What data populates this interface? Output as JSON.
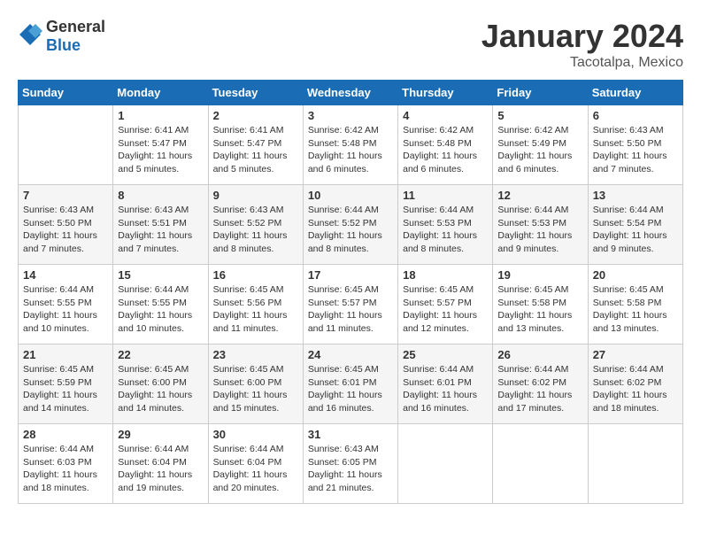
{
  "logo": {
    "general": "General",
    "blue": "Blue"
  },
  "header": {
    "month": "January 2024",
    "location": "Tacotalpa, Mexico"
  },
  "weekdays": [
    "Sunday",
    "Monday",
    "Tuesday",
    "Wednesday",
    "Thursday",
    "Friday",
    "Saturday"
  ],
  "weeks": [
    [
      {
        "day": "",
        "info": ""
      },
      {
        "day": "1",
        "info": "Sunrise: 6:41 AM\nSunset: 5:47 PM\nDaylight: 11 hours\nand 5 minutes."
      },
      {
        "day": "2",
        "info": "Sunrise: 6:41 AM\nSunset: 5:47 PM\nDaylight: 11 hours\nand 5 minutes."
      },
      {
        "day": "3",
        "info": "Sunrise: 6:42 AM\nSunset: 5:48 PM\nDaylight: 11 hours\nand 6 minutes."
      },
      {
        "day": "4",
        "info": "Sunrise: 6:42 AM\nSunset: 5:48 PM\nDaylight: 11 hours\nand 6 minutes."
      },
      {
        "day": "5",
        "info": "Sunrise: 6:42 AM\nSunset: 5:49 PM\nDaylight: 11 hours\nand 6 minutes."
      },
      {
        "day": "6",
        "info": "Sunrise: 6:43 AM\nSunset: 5:50 PM\nDaylight: 11 hours\nand 7 minutes."
      }
    ],
    [
      {
        "day": "7",
        "info": "Sunrise: 6:43 AM\nSunset: 5:50 PM\nDaylight: 11 hours\nand 7 minutes."
      },
      {
        "day": "8",
        "info": "Sunrise: 6:43 AM\nSunset: 5:51 PM\nDaylight: 11 hours\nand 7 minutes."
      },
      {
        "day": "9",
        "info": "Sunrise: 6:43 AM\nSunset: 5:52 PM\nDaylight: 11 hours\nand 8 minutes."
      },
      {
        "day": "10",
        "info": "Sunrise: 6:44 AM\nSunset: 5:52 PM\nDaylight: 11 hours\nand 8 minutes."
      },
      {
        "day": "11",
        "info": "Sunrise: 6:44 AM\nSunset: 5:53 PM\nDaylight: 11 hours\nand 8 minutes."
      },
      {
        "day": "12",
        "info": "Sunrise: 6:44 AM\nSunset: 5:53 PM\nDaylight: 11 hours\nand 9 minutes."
      },
      {
        "day": "13",
        "info": "Sunrise: 6:44 AM\nSunset: 5:54 PM\nDaylight: 11 hours\nand 9 minutes."
      }
    ],
    [
      {
        "day": "14",
        "info": "Sunrise: 6:44 AM\nSunset: 5:55 PM\nDaylight: 11 hours\nand 10 minutes."
      },
      {
        "day": "15",
        "info": "Sunrise: 6:44 AM\nSunset: 5:55 PM\nDaylight: 11 hours\nand 10 minutes."
      },
      {
        "day": "16",
        "info": "Sunrise: 6:45 AM\nSunset: 5:56 PM\nDaylight: 11 hours\nand 11 minutes."
      },
      {
        "day": "17",
        "info": "Sunrise: 6:45 AM\nSunset: 5:57 PM\nDaylight: 11 hours\nand 11 minutes."
      },
      {
        "day": "18",
        "info": "Sunrise: 6:45 AM\nSunset: 5:57 PM\nDaylight: 11 hours\nand 12 minutes."
      },
      {
        "day": "19",
        "info": "Sunrise: 6:45 AM\nSunset: 5:58 PM\nDaylight: 11 hours\nand 13 minutes."
      },
      {
        "day": "20",
        "info": "Sunrise: 6:45 AM\nSunset: 5:58 PM\nDaylight: 11 hours\nand 13 minutes."
      }
    ],
    [
      {
        "day": "21",
        "info": "Sunrise: 6:45 AM\nSunset: 5:59 PM\nDaylight: 11 hours\nand 14 minutes."
      },
      {
        "day": "22",
        "info": "Sunrise: 6:45 AM\nSunset: 6:00 PM\nDaylight: 11 hours\nand 14 minutes."
      },
      {
        "day": "23",
        "info": "Sunrise: 6:45 AM\nSunset: 6:00 PM\nDaylight: 11 hours\nand 15 minutes."
      },
      {
        "day": "24",
        "info": "Sunrise: 6:45 AM\nSunset: 6:01 PM\nDaylight: 11 hours\nand 16 minutes."
      },
      {
        "day": "25",
        "info": "Sunrise: 6:44 AM\nSunset: 6:01 PM\nDaylight: 11 hours\nand 16 minutes."
      },
      {
        "day": "26",
        "info": "Sunrise: 6:44 AM\nSunset: 6:02 PM\nDaylight: 11 hours\nand 17 minutes."
      },
      {
        "day": "27",
        "info": "Sunrise: 6:44 AM\nSunset: 6:02 PM\nDaylight: 11 hours\nand 18 minutes."
      }
    ],
    [
      {
        "day": "28",
        "info": "Sunrise: 6:44 AM\nSunset: 6:03 PM\nDaylight: 11 hours\nand 18 minutes."
      },
      {
        "day": "29",
        "info": "Sunrise: 6:44 AM\nSunset: 6:04 PM\nDaylight: 11 hours\nand 19 minutes."
      },
      {
        "day": "30",
        "info": "Sunrise: 6:44 AM\nSunset: 6:04 PM\nDaylight: 11 hours\nand 20 minutes."
      },
      {
        "day": "31",
        "info": "Sunrise: 6:43 AM\nSunset: 6:05 PM\nDaylight: 11 hours\nand 21 minutes."
      },
      {
        "day": "",
        "info": ""
      },
      {
        "day": "",
        "info": ""
      },
      {
        "day": "",
        "info": ""
      }
    ]
  ]
}
